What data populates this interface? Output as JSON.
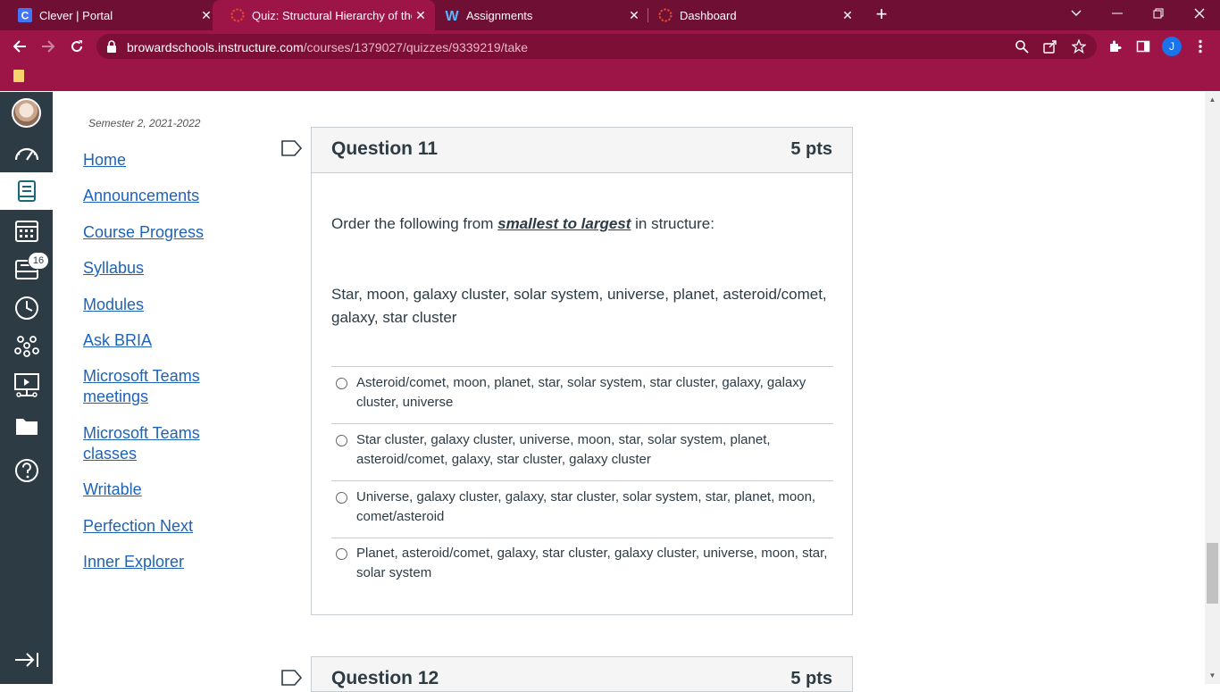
{
  "browser": {
    "tabs": [
      {
        "title": "Clever | Portal",
        "close": "✕"
      },
      {
        "title": "Quiz: Structural Hierarchy of the U",
        "close": "✕"
      },
      {
        "title": "Assignments",
        "close": "✕"
      },
      {
        "title": "Dashboard",
        "close": "✕"
      }
    ],
    "new_tab": "+",
    "url_host": "browardschools.instructure.com",
    "url_path": "/courses/1379027/quizzes/9339219/take",
    "profile_initial": "J"
  },
  "global_nav": {
    "inbox_badge": "16"
  },
  "course_nav": {
    "term": "Semester 2, 2021-2022",
    "items": [
      {
        "label": "Home"
      },
      {
        "label": "Announcements"
      },
      {
        "label": "Course Progress"
      },
      {
        "label": "Syllabus"
      },
      {
        "label": "Modules"
      },
      {
        "label": "Ask BRIA"
      },
      {
        "label": "Microsoft Teams meetings"
      },
      {
        "label": "Microsoft Teams classes"
      },
      {
        "label": "Writable"
      },
      {
        "label": "Perfection Next"
      },
      {
        "label": "Inner Explorer"
      }
    ]
  },
  "question": {
    "title": "Question 11",
    "points": "5 pts",
    "prompt_before": "Order the following from ",
    "prompt_emphasis": "smallest to largest",
    "prompt_after": " in structure:",
    "items_text": "Star, moon, galaxy cluster, solar system, universe, planet, asteroid/comet, galaxy, star cluster",
    "answers": [
      {
        "text": "Asteroid/comet, moon, planet, star, solar system, star cluster, galaxy, galaxy cluster, universe"
      },
      {
        "text": "Star cluster, galaxy cluster, universe, moon, star, solar system, planet, asteroid/comet, galaxy, star cluster, galaxy cluster"
      },
      {
        "text": "Universe, galaxy cluster, galaxy, star cluster, solar system, star, planet, moon, comet/asteroid"
      },
      {
        "text": "Planet, asteroid/comet, galaxy, star cluster, galaxy cluster, universe, moon, star, solar system"
      }
    ]
  },
  "next_question": {
    "title": "Question 12",
    "points": "5 pts"
  }
}
